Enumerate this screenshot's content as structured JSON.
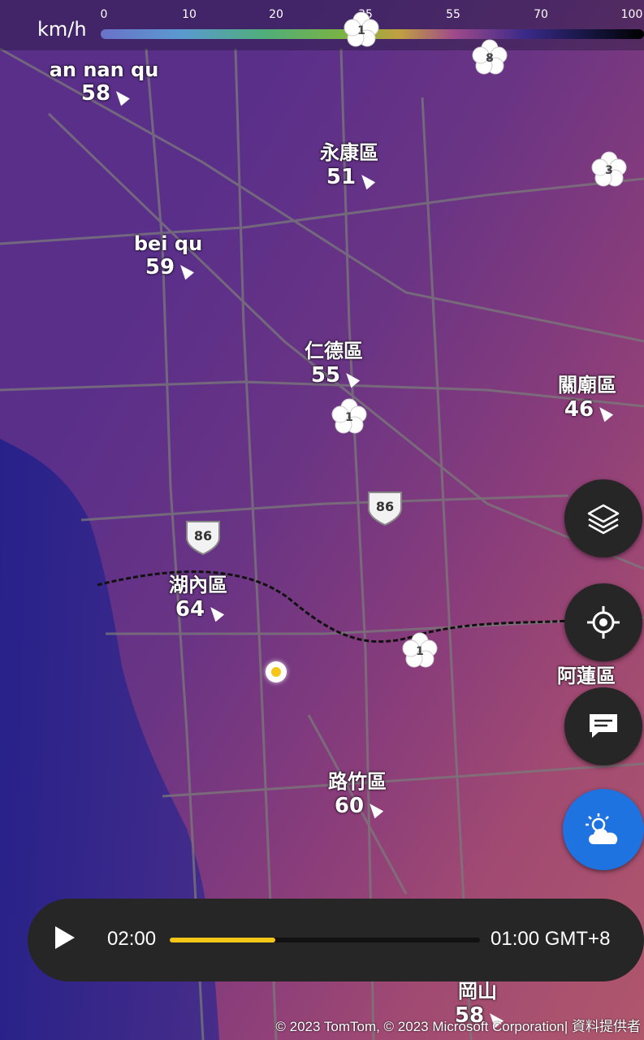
{
  "legend": {
    "unit": "km/h",
    "ticks": [
      "0",
      "10",
      "20",
      "35",
      "55",
      "70",
      "100"
    ]
  },
  "cities": [
    {
      "name": "an nan qu",
      "value": "58"
    },
    {
      "name": "永康區",
      "value": "51"
    },
    {
      "name": "bei qu",
      "value": "59"
    },
    {
      "name": "仁德區",
      "value": "55"
    },
    {
      "name": "關廟區",
      "value": "46"
    },
    {
      "name": "湖內區",
      "value": "64"
    },
    {
      "name": "阿蓮區",
      "value": ""
    },
    {
      "name": "路竹區",
      "value": "60"
    },
    {
      "name": "岡山",
      "value": "58"
    }
  ],
  "road_shields": [
    "86",
    "86"
  ],
  "flower_markers": [
    "1",
    "8",
    "3",
    "1",
    "1"
  ],
  "controls": {
    "layers_icon": "layers-icon",
    "locate_icon": "crosshair-icon",
    "feedback_icon": "chat-icon",
    "weather_icon": "weather-cloud-sun-icon"
  },
  "player": {
    "current_time": "02:00",
    "end_time": "01:00 GMT+8",
    "progress": 0.34,
    "colors": {
      "progress": "#f5c518",
      "weather_button": "#1f73e0"
    }
  },
  "copyright": "© 2023 TomTom, © 2023 Microsoft Corporation|  資料提供者"
}
